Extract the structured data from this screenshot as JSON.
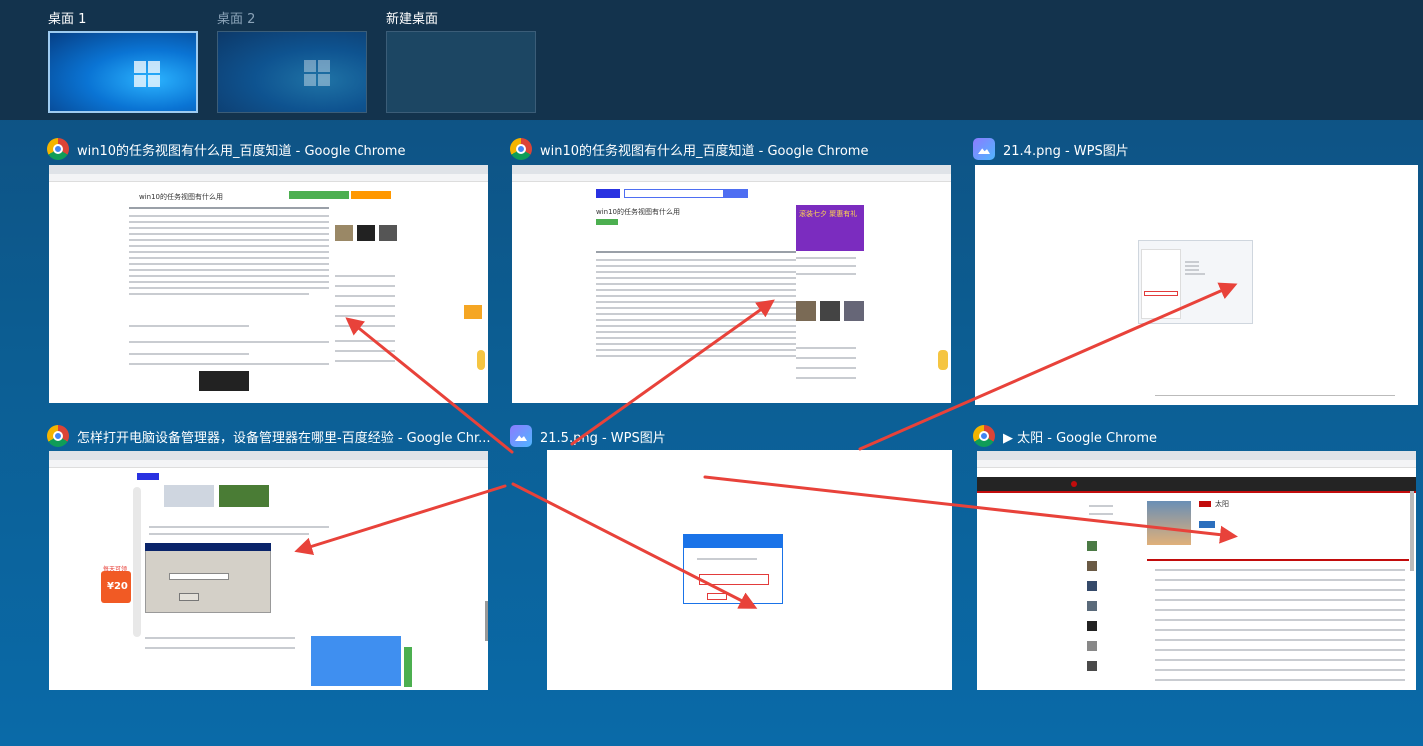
{
  "desktops": [
    {
      "label": "桌面 1",
      "active": true
    },
    {
      "label": "桌面 2",
      "active": false
    },
    {
      "label": "新建桌面",
      "active": false
    }
  ],
  "windows": [
    {
      "title": "win10的任务视图有什么用_百度知道 - Google Chrome",
      "icon": "chrome-icon"
    },
    {
      "title": "win10的任务视图有什么用_百度知道 - Google Chrome",
      "icon": "chrome-icon"
    },
    {
      "title": "21.4.png - WPS图片",
      "icon": "wps-photo-icon"
    },
    {
      "title": "怎样打开电脑设备管理器，设备管理器在哪里-百度经验 - Google Chr...",
      "icon": "chrome-icon"
    },
    {
      "title": "21.5.png - WPS图片",
      "icon": "wps-photo-icon"
    },
    {
      "title": "▶ 太阳 - Google Chrome",
      "icon": "chrome-icon"
    }
  ],
  "thumb_text": {
    "w1_heading": "win10的任务视图有什么用",
    "w2_heading": "win10的任务视图有什么用",
    "w2_ad": "滚装七夕 聚惠有礼",
    "w4_badge": "每天可领",
    "w4_amount": "¥20",
    "w6_song": "太阳"
  },
  "colors": {
    "arrow": "#e8423a",
    "desk_strip": "#13334d",
    "active_border": "#9ecbf0"
  }
}
